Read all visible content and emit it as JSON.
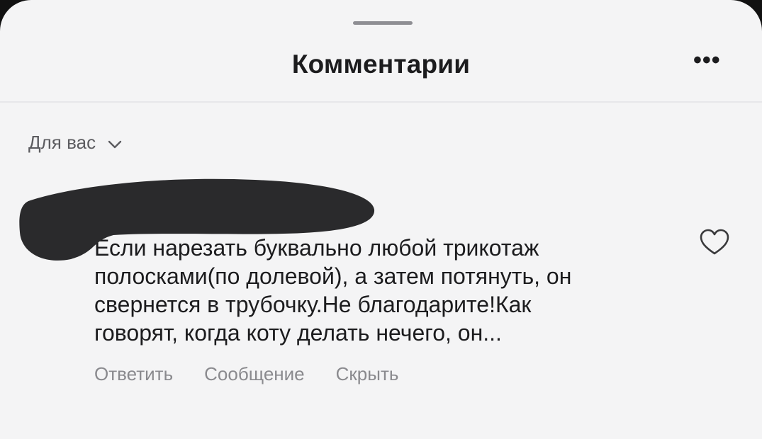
{
  "header": {
    "title": "Комментарии",
    "more_label": "•••"
  },
  "filter": {
    "label": "Для вас",
    "chevron_icon": "chevron-down-icon"
  },
  "comment": {
    "author_redacted": true,
    "lines": [
      "Если нарезать буквально любой трикотаж",
      "полосками(по долевой), а затем потянуть, он",
      "свернется в трубочку.Не благодарите!Как",
      "говорят, когда коту делать нечего, он..."
    ],
    "like_icon": "heart-outline-icon",
    "actions": {
      "reply": "Ответить",
      "message": "Сообщение",
      "hide": "Скрыть"
    }
  },
  "colors": {
    "background": "#f4f4f5",
    "primary_text": "#1c1c1e",
    "secondary_text": "#8a8a8e",
    "redaction": "#2a2a2c"
  }
}
